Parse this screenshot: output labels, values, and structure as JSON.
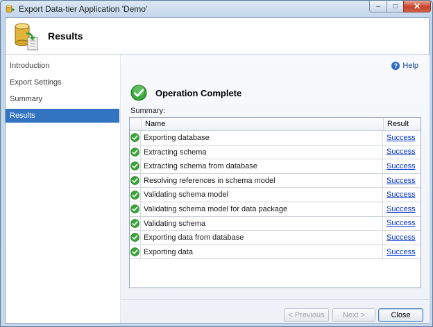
{
  "window": {
    "title": "Export Data-tier Application 'Demo'",
    "controls": {
      "minimize": "‒",
      "maximize": "□",
      "close": "✕"
    }
  },
  "header": {
    "title": "Results"
  },
  "nav": {
    "items": [
      {
        "label": "Introduction",
        "selected": false
      },
      {
        "label": "Export Settings",
        "selected": false
      },
      {
        "label": "Summary",
        "selected": false
      },
      {
        "label": "Results",
        "selected": true
      }
    ]
  },
  "main": {
    "help_label": "Help",
    "operation_title": "Operation Complete",
    "summary_label": "Summary:",
    "columns": {
      "name": "Name",
      "result": "Result"
    },
    "rows": [
      {
        "name": "Exporting database",
        "result": "Success"
      },
      {
        "name": "Extracting schema",
        "result": "Success"
      },
      {
        "name": "Extracting schema from database",
        "result": "Success"
      },
      {
        "name": "Resolving references in schema model",
        "result": "Success"
      },
      {
        "name": "Validating schema model",
        "result": "Success"
      },
      {
        "name": "Validating schema model for data package",
        "result": "Success"
      },
      {
        "name": "Validating schema",
        "result": "Success"
      },
      {
        "name": "Exporting data from database",
        "result": "Success"
      },
      {
        "name": "Exporting data",
        "result": "Success"
      }
    ]
  },
  "buttons": {
    "previous": "< Previous",
    "next": "Next >",
    "close": "Close"
  },
  "colors": {
    "selection": "#3374c1",
    "success_green": "#3aa63a",
    "link": "#0033cc"
  },
  "icons": {
    "window": "database-export-icon",
    "header": "database-export-icon",
    "status": "green-check-icon",
    "help": "help-icon"
  }
}
